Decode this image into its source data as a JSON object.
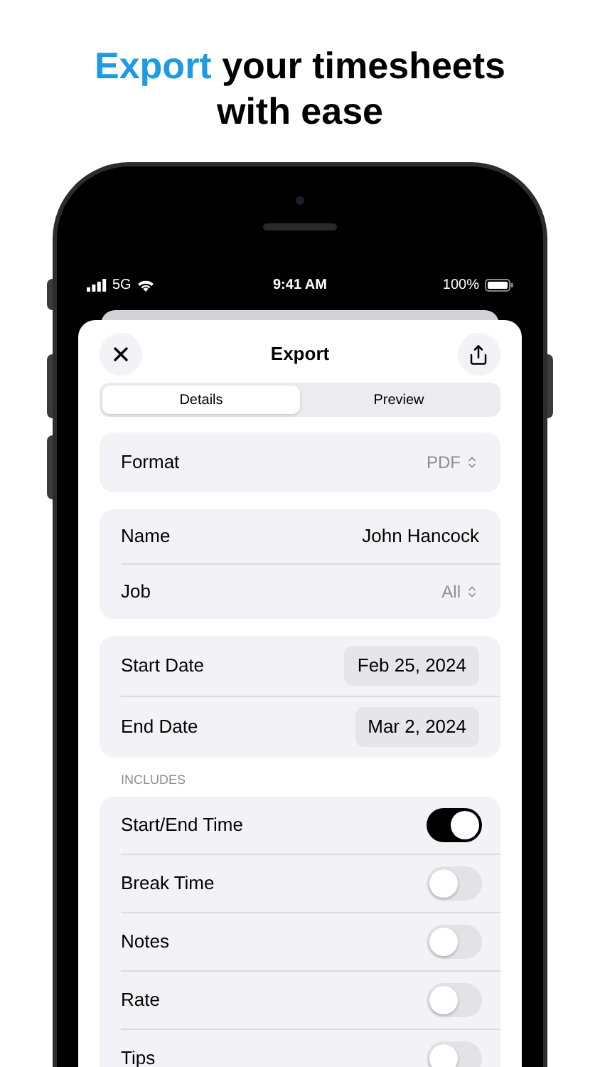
{
  "headline": {
    "accent": "Export",
    "text": "your timesheets with ease"
  },
  "status_bar": {
    "network": "5G",
    "time": "9:41 AM",
    "battery": "100%"
  },
  "sheet": {
    "title": "Export"
  },
  "tabs": [
    {
      "label": "Details",
      "selected": true
    },
    {
      "label": "Preview",
      "selected": false
    }
  ],
  "groups": [
    {
      "rows": [
        {
          "kind": "picker",
          "label": "Format",
          "value": "PDF"
        }
      ]
    },
    {
      "rows": [
        {
          "kind": "text",
          "label": "Name",
          "value": "John Hancock"
        },
        {
          "kind": "picker",
          "label": "Job",
          "value": "All"
        }
      ]
    },
    {
      "rows": [
        {
          "kind": "date",
          "label": "Start Date",
          "value": "Feb 25, 2024"
        },
        {
          "kind": "date",
          "label": "End Date",
          "value": "Mar 2, 2024"
        }
      ]
    },
    {
      "header": "INCLUDES",
      "rows": [
        {
          "kind": "toggle",
          "label": "Start/End Time",
          "on": true
        },
        {
          "kind": "toggle",
          "label": "Break Time",
          "on": false
        },
        {
          "kind": "toggle",
          "label": "Notes",
          "on": false
        },
        {
          "kind": "toggle",
          "label": "Rate",
          "on": false
        },
        {
          "kind": "toggle",
          "label": "Tips",
          "on": false
        }
      ]
    }
  ]
}
